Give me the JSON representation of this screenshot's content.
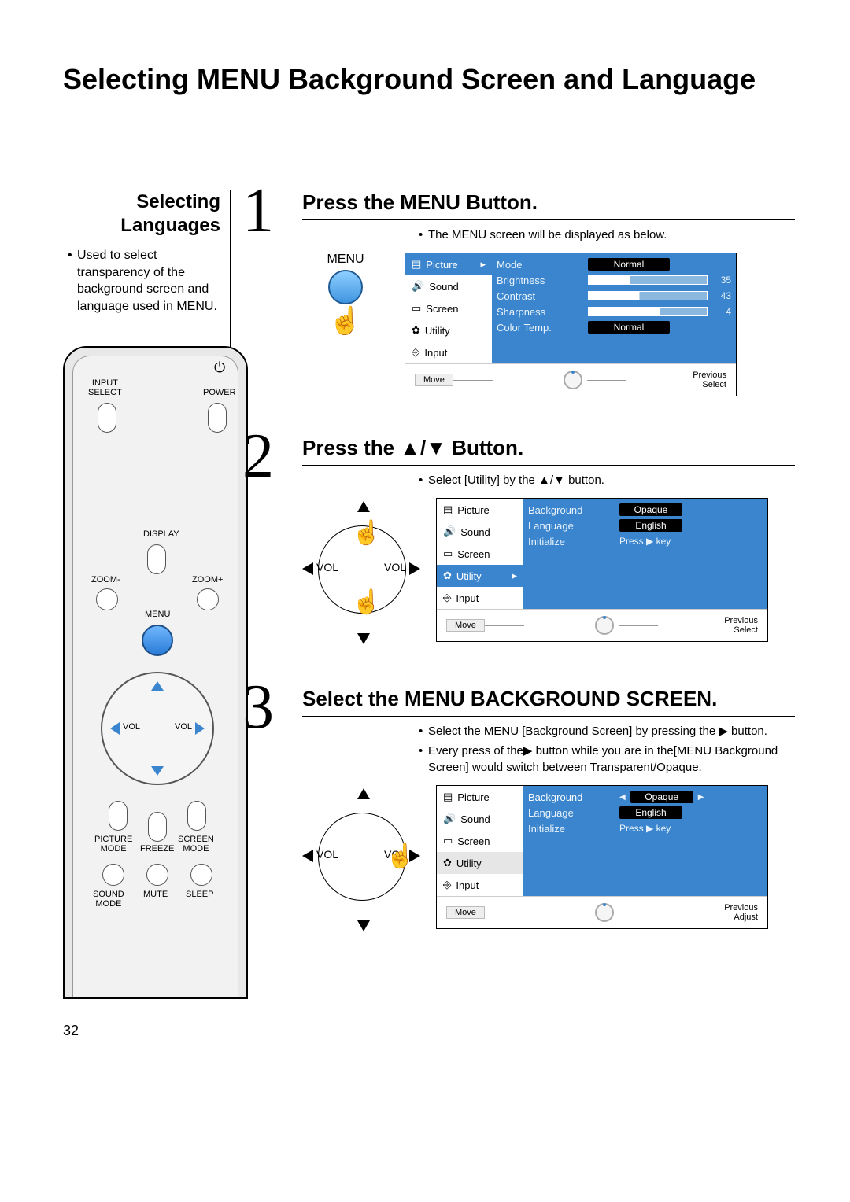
{
  "title": "Selecting MENU Background Screen and Language",
  "page_number": "32",
  "left": {
    "subtitle_line1": "Selecting",
    "subtitle_line2": "Languages",
    "desc": "Used to select transparency of the background screen and language used in MENU."
  },
  "remote": {
    "input_select": "INPUT\nSELECT",
    "power": "POWER",
    "display": "DISPLAY",
    "zoom_minus": "ZOOM-",
    "zoom_plus": "ZOOM+",
    "menu": "MENU",
    "vol_l": "VOL",
    "vol_r": "VOL",
    "picture_mode": "PICTURE\nMODE",
    "freeze": "FREEZE",
    "screen_mode": "SCREEN\nMODE",
    "sound_mode": "SOUND\nMODE",
    "mute": "MUTE",
    "sleep": "SLEEP"
  },
  "steps": {
    "s1": {
      "num": "1",
      "title": "Press the MENU Button.",
      "bullet1": "The MENU screen will be displayed as below.",
      "menu_label": "MENU"
    },
    "s2": {
      "num": "2",
      "title": "Press the ▲/▼ Button.",
      "bullet1": "Select [Utility] by the ▲/▼ button.",
      "vol_l": "VOL",
      "vol_r": "VOL"
    },
    "s3": {
      "num": "3",
      "title": "Select the MENU BACKGROUND SCREEN.",
      "bullet1": "Select the MENU [Background Screen] by pressing the ▶ button.",
      "bullet2": "Every press of the▶ button while you are in the[MENU Background Screen] would switch between Transparent/Opaque.",
      "vol_l": "VOL",
      "vol_r": "VOL"
    }
  },
  "osd_tabs": {
    "picture": "Picture",
    "sound": "Sound",
    "screen": "Screen",
    "utility": "Utility",
    "input": "Input"
  },
  "osd1": {
    "mode": "Mode",
    "mode_val": "Normal",
    "brightness": "Brightness",
    "brightness_val": "35",
    "contrast": "Contrast",
    "contrast_val": "43",
    "sharpness": "Sharpness",
    "sharpness_val": "4",
    "colortemp": "Color Temp.",
    "colortemp_val": "Normal"
  },
  "osd2": {
    "background": "Background",
    "background_val": "Opaque",
    "language": "Language",
    "language_val": "English",
    "initialize": "Initialize",
    "initialize_val": "Press ▶ key"
  },
  "osd3": {
    "background": "Background",
    "background_val": "Opaque",
    "language": "Language",
    "language_val": "English",
    "initialize": "Initialize",
    "initialize_val": "Press ▶ key"
  },
  "osd_footer": {
    "move": "Move",
    "previous": "Previous",
    "select": "Select",
    "adjust": "Adjust"
  }
}
